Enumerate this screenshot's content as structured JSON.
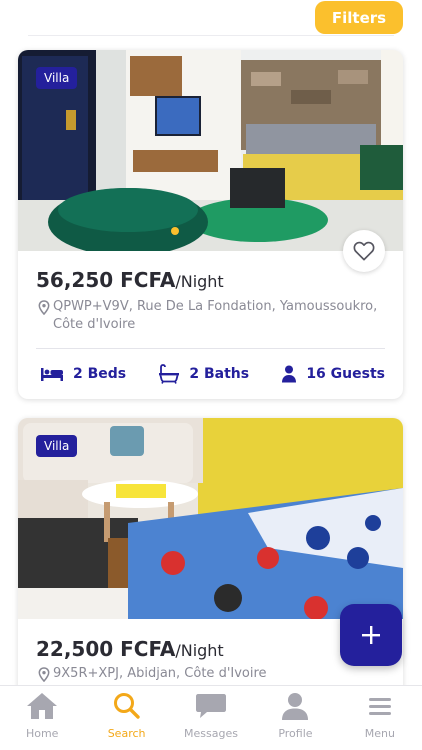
{
  "header": {
    "filters_label": "Filters"
  },
  "listings": [
    {
      "type": "Villa",
      "price": "56,250 FCFA",
      "unit": "/Night",
      "address": "QPWP+V9V, Rue De La Fondation, Yamoussoukro, Côte d'Ivoire",
      "beds": "2 Beds",
      "baths": "2 Baths",
      "guests": "16 Guests"
    },
    {
      "type": "Villa",
      "price": "22,500 FCFA",
      "unit": "/Night",
      "address": "9X5R+XPJ, Abidjan, Côte d'Ivoire"
    }
  ],
  "nav": [
    {
      "label": "Home",
      "icon": "home-icon"
    },
    {
      "label": "Search",
      "icon": "search-icon",
      "active": true
    },
    {
      "label": "Messages",
      "icon": "chat-icon"
    },
    {
      "label": "Profile",
      "icon": "person-icon"
    },
    {
      "label": "Menu",
      "icon": "menu-icon"
    }
  ],
  "colors": {
    "accent": "#fbc02d",
    "brand": "#24209c",
    "muted": "#a7a7b0",
    "active_nav": "#f3a819"
  }
}
